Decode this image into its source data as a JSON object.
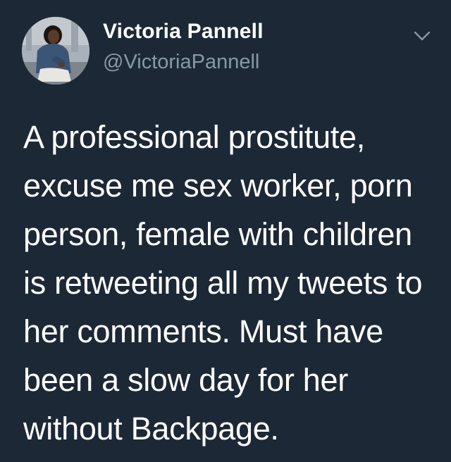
{
  "author": {
    "display_name": "Victoria Pannell",
    "handle": "@VictoriaPannell",
    "avatar_icon": "profile-photo"
  },
  "menu": {
    "icon": "chevron-down-icon"
  },
  "tweet": {
    "text": "A professional prostitute,\nexcuse me sex worker, porn\nperson, female with children\nis retweeting all my tweets to\nher comments. Must have\nbeen a slow day for her\nwithout Backpage."
  },
  "colors": {
    "background": "#1c2836",
    "primary_text": "#ffffff",
    "secondary_text": "#8899a6"
  }
}
